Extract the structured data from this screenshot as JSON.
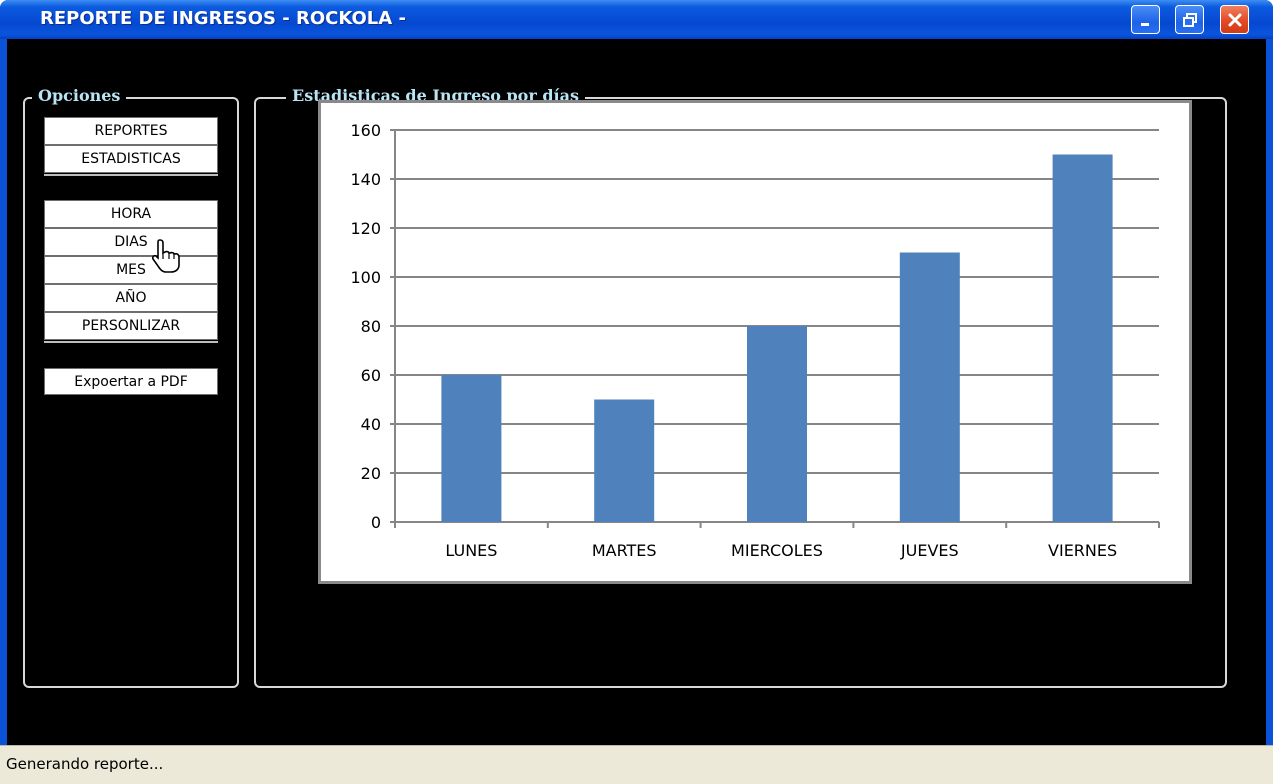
{
  "window": {
    "title": "REPORTE DE INGRESOS - ROCKOLA -"
  },
  "options": {
    "legend": "Opciones",
    "group1": [
      "REPORTES",
      "ESTADISTICAS"
    ],
    "group2": [
      "HORA",
      "DIAS",
      "MES",
      "AÑO",
      "PERSONLIZAR"
    ],
    "export_label": "Expoertar a PDF"
  },
  "stats": {
    "legend": "Estadisticas de Ingreso por días"
  },
  "status": {
    "text": "Generando reporte..."
  },
  "colors": {
    "bar": "#4f81bd",
    "legend_text": "#b9e4f4",
    "titlebar": "#0a53d8"
  },
  "chart_data": {
    "type": "bar",
    "categories": [
      "LUNES",
      "MARTES",
      "MIERCOLES",
      "JUEVES",
      "VIERNES"
    ],
    "values": [
      60,
      50,
      80,
      110,
      150
    ],
    "title": "",
    "xlabel": "",
    "ylabel": "",
    "ylim": [
      0,
      160
    ],
    "yticks": [
      0,
      20,
      40,
      60,
      80,
      100,
      120,
      140,
      160
    ],
    "grid": true,
    "legend": "none"
  }
}
